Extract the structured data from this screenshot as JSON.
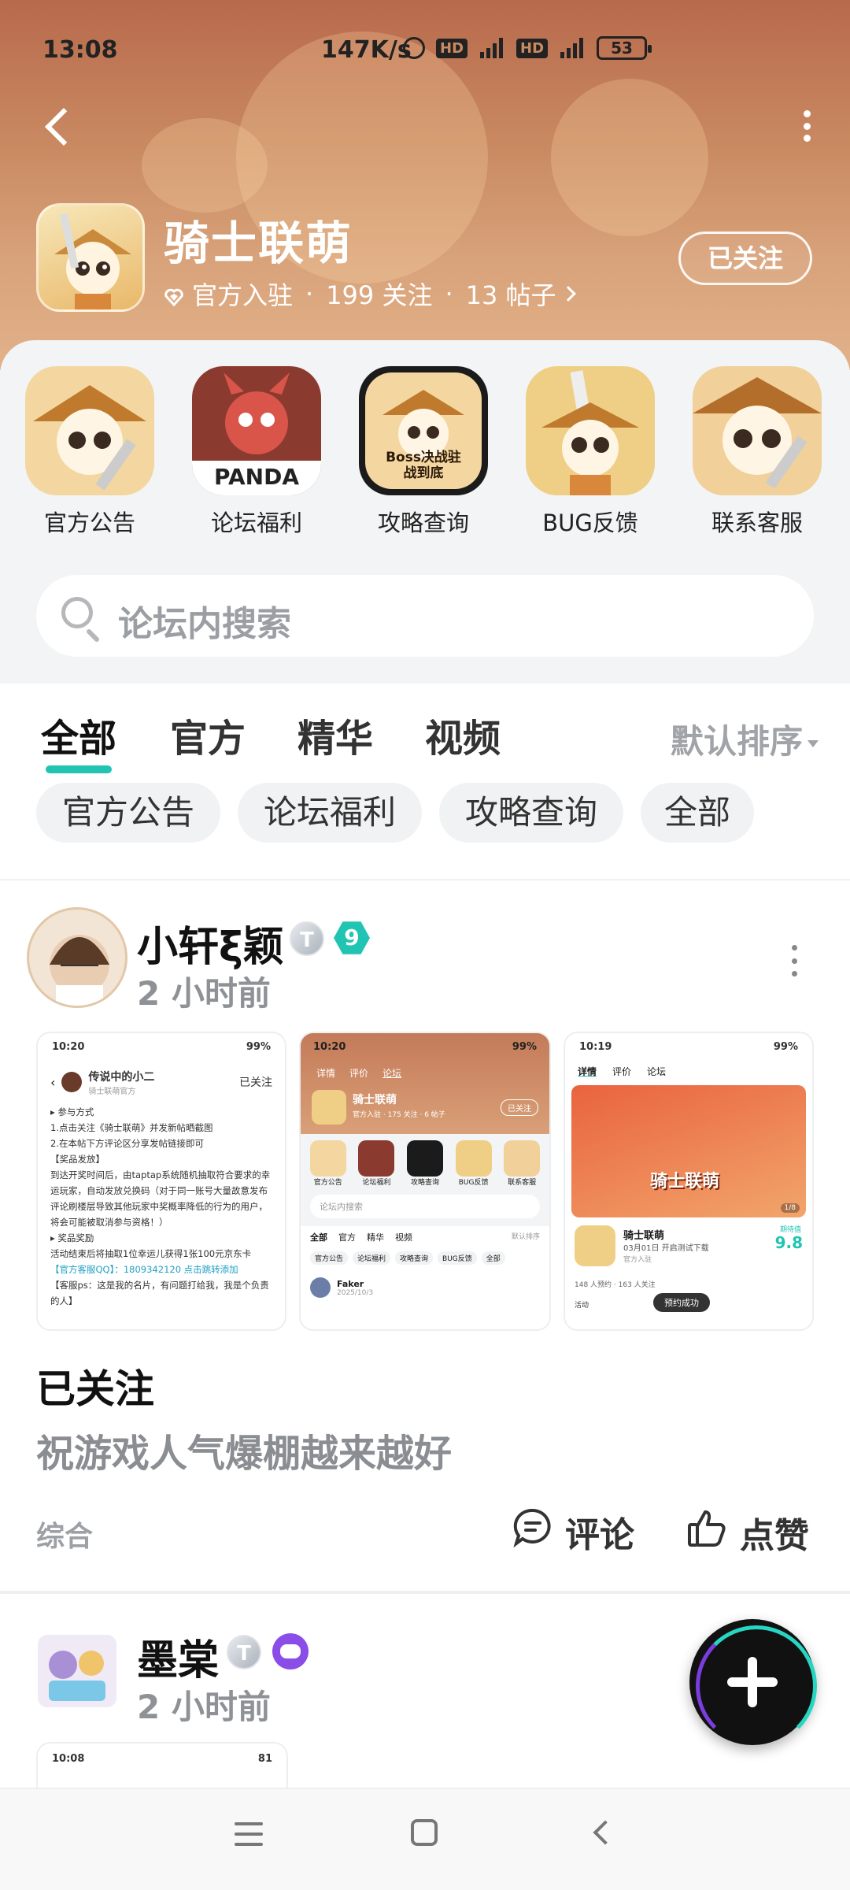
{
  "status_bar": {
    "time": "13:08",
    "network_speed": "147K/s",
    "battery": "53"
  },
  "forum": {
    "name": "骑士联萌",
    "official_label": "官方入驻",
    "followers": "199 关注",
    "posts": "13 帖子",
    "separator": "·",
    "follow_button": "已关注"
  },
  "shortcuts": [
    {
      "label": "官方公告",
      "icon": "panda-knight-icon"
    },
    {
      "label": "论坛福利",
      "icon": "panda-dragon-icon",
      "icon_text": "PANDA"
    },
    {
      "label": "攻略查询",
      "icon": "boss-guide-icon",
      "icon_text": "Boss决战驻战到底"
    },
    {
      "label": "BUG反馈",
      "icon": "panda-sword-icon"
    },
    {
      "label": "联系客服",
      "icon": "panda-hat-icon"
    }
  ],
  "search": {
    "placeholder": "论坛内搜索"
  },
  "tabs": [
    "全部",
    "官方",
    "精华",
    "视频"
  ],
  "active_tab": "全部",
  "sort": "默认排序",
  "chips": [
    "官方公告",
    "论坛福利",
    "攻略查询",
    "全部"
  ],
  "posts": [
    {
      "author": "小轩ξ颖",
      "time": "2 小时前",
      "level": "9",
      "badge_t": "T",
      "title": "已关注",
      "body": "祝游戏人气爆棚越来越好",
      "category": "综合",
      "comment_label": "评论",
      "like_label": "点赞",
      "screenshots": [
        {
          "status_time": "10:20",
          "status_batt": "99%",
          "header": "传说中的小二",
          "sub": "骑士联萌官方",
          "btn": "已关注",
          "lines": [
            "▸ 参与方式",
            "1.点击关注《骑士联萌》并发新帖晒截图",
            "2.在本帖下方评论区分享发帖链接即可",
            "【奖品发放】",
            "到达开奖时间后，由taptap系统随机抽取符合要求的幸",
            "运玩家，自动发放兑换码（对于同一账号大量故意发布",
            "评论刷楼层导致其他玩家中奖概率降低的行为的用户，",
            "将会可能被取消参与资格！）",
            "▸ 奖品奖励",
            "活动结束后将抽取1位幸运儿获得1张100元京东卡",
            "【官方客服QQ】：1809342120 点击跳转添加",
            "【客服ps：这是我的名片，有问题打给我，我是个负责",
            "的人】"
          ]
        },
        {
          "status_time": "10:20",
          "status_batt": "99%",
          "tabs": [
            "详情",
            "评价",
            "论坛"
          ],
          "name": "骑士联萌",
          "meta": "官方入驻 · 175 关注 · 6 帖子",
          "btn": "已关注",
          "shortcut_labels": [
            "官方公告",
            "论坛福利",
            "攻略查询",
            "BUG反馈",
            "联系客服"
          ],
          "search": "论坛内搜索",
          "feed_tabs": [
            "全部",
            "官方",
            "精华",
            "视频"
          ],
          "sort": "默认排序",
          "chips": [
            "官方公告",
            "论坛福利",
            "攻略查询",
            "BUG反馈",
            "全部"
          ],
          "author": "Faker",
          "date": "2025/10/3"
        },
        {
          "status_time": "10:19",
          "status_batt": "99%",
          "tabs": [
            "详情",
            "评价",
            "论坛"
          ],
          "banner_text": "骑士联萌",
          "page": "1/8",
          "name": "骑士联萌",
          "release": "03月01日 开启测试下载",
          "official": "官方入驻",
          "score_label": "期待值",
          "score": "9.8",
          "stats": "148 人预约 · 163 人关注",
          "btn": "预约成功",
          "bottom": "活动"
        }
      ]
    },
    {
      "author": "墨棠",
      "time": "2 小时前",
      "badge_t": "T",
      "preview_time": "10:08",
      "preview_batt": "81"
    }
  ],
  "colors": {
    "accent": "#21c4b2",
    "banner": "#c98a62",
    "fab_ring_a": "#27d6c2",
    "fab_ring_b": "#7a3de0"
  }
}
